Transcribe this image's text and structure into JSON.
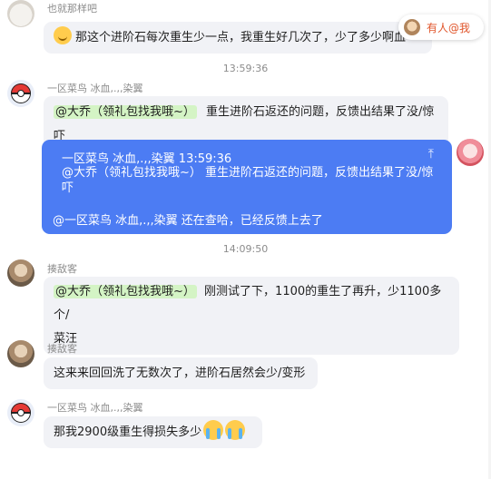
{
  "messages": [
    {
      "sender": "也就那样吧",
      "text": "那这个进阶石每次重生少一点，我重生好几次了，少了多少啊血"
    },
    {
      "sender": "一区菜鸟 冰血,.,,染翼",
      "mention": "@大乔（领礼包找我哦~）",
      "text": "重生进阶石返还的问题，反馈出结果了没/惊吓"
    },
    {
      "sender": "揍敌客",
      "mention": "@大乔（领礼包找我哦~）",
      "text_line1": "刚测试了下，1100的重生了再升，少1100多个/",
      "text_line2": "菜汪"
    },
    {
      "sender": "揍敌客",
      "text": "这来来回回洗了无数次了，进阶石居然会少/变形"
    },
    {
      "sender": "一区菜鸟 冰血,.,,染翼",
      "text": "那我2900级重生得损失多少"
    }
  ],
  "timestamps": [
    "13:59:36",
    "14:09:50"
  ],
  "self_message": {
    "reply_header": "一区菜鸟 冰血,.,,染翼   13:59:36",
    "reply_text": "@大乔（领礼包找我哦~）  重生进阶石返还的问题，反馈出结果了没/惊吓",
    "text": "@一区菜鸟 冰血,.,,染翼 还在查哈，已经反馈上去了"
  },
  "at_notice": "有人@我",
  "icons": {
    "emoji_1": "smile-emoji-icon",
    "emoji_2": "crying-emoji-icon",
    "scroll": "up-arrow-icon"
  },
  "colors": {
    "self_bubble": "#4c7cf3",
    "other_bubble": "#f1f2f6",
    "mention_highlight": "#d4f4c5",
    "at_notice_text": "#e0552b"
  }
}
